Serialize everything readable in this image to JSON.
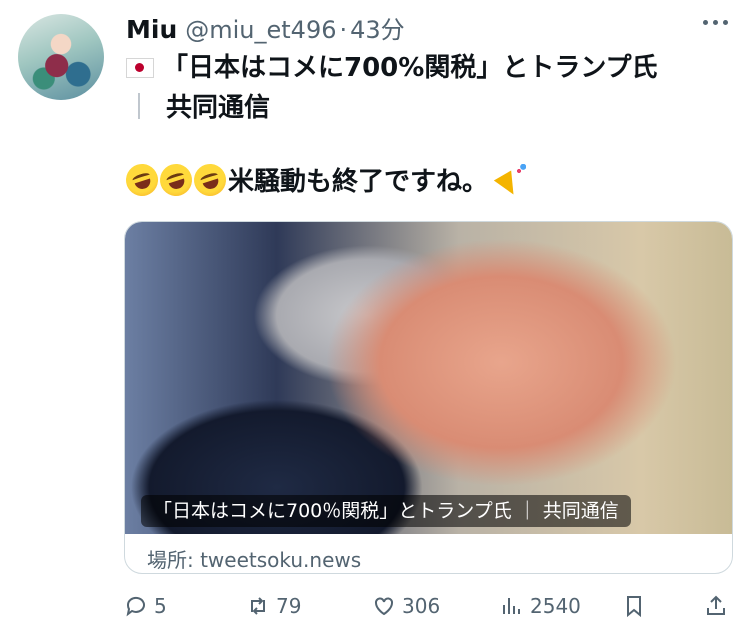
{
  "author": {
    "name": "Miu",
    "handle": "@miu_et496",
    "separator": "·",
    "time": "43分"
  },
  "post": {
    "line1": "「日本はコメに700%関税」とトランプ氏",
    "line2_sep": "｜",
    "line2": "共同通信",
    "line3": "米騒動も終了ですね。"
  },
  "card": {
    "caption": "「日本はコメに700％関税」とトランプ氏 ｜ 共同通信",
    "source": "場所: tweetsoku.news"
  },
  "actions": {
    "replies": "5",
    "reposts": "79",
    "likes": "306",
    "views": "2540"
  },
  "icons": {
    "flag": "japan-flag-icon",
    "laugh": "rolling-on-floor-laughing-icon",
    "party": "party-popper-icon"
  }
}
